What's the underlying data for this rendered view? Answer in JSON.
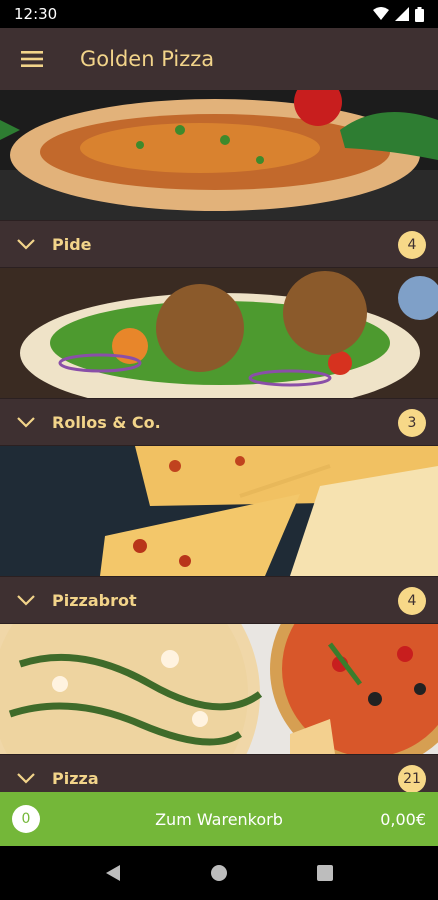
{
  "status": {
    "time": "12:30"
  },
  "app": {
    "title": "Golden Pizza"
  },
  "categories": [
    {
      "name": "Pide",
      "count": "4"
    },
    {
      "name": "Rollos & Co.",
      "count": "3"
    },
    {
      "name": "Pizzabrot",
      "count": "4"
    },
    {
      "name": "Pizza",
      "count": "21"
    }
  ],
  "cart": {
    "count": "0",
    "label": "Zum Warenkorb",
    "total": "0,00€"
  },
  "colors": {
    "appbar": "#3e3031",
    "accent": "#f2d48a",
    "badge": "#f7d888",
    "cart": "#74b739"
  },
  "icons": [
    "wifi-icon",
    "signal-icon",
    "battery-icon",
    "menu-icon",
    "chevron-down-icon",
    "back-icon",
    "home-icon",
    "recents-icon"
  ]
}
